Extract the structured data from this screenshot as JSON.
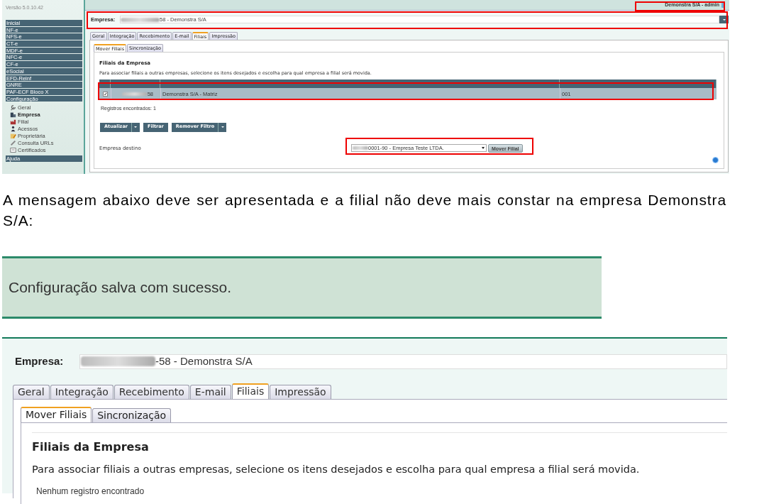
{
  "screenshot_1": {
    "version": "Versão 5.0.10.42",
    "user": "Demonstra S/A - admin",
    "sidebar": [
      {
        "label": "Inicial"
      },
      {
        "label": "NF-e"
      },
      {
        "label": "NFS-e"
      },
      {
        "label": "CT-e"
      },
      {
        "label": "MDF-e"
      },
      {
        "label": "NFC-e"
      },
      {
        "label": "CF-e"
      },
      {
        "label": "eSocial"
      },
      {
        "label": "EFD-Reinf"
      },
      {
        "label": "GNRE"
      },
      {
        "label": "PAF-ECF Bloco X"
      },
      {
        "label": "Configuração",
        "children": [
          {
            "label": "Geral",
            "selected": false
          },
          {
            "label": "Empresa",
            "selected": true
          },
          {
            "label": "Filial",
            "selected": false
          },
          {
            "label": "Acessos",
            "selected": false
          },
          {
            "label": "Proprietária",
            "selected": false
          },
          {
            "label": "Consulta URLs",
            "selected": false
          },
          {
            "label": "Certificados",
            "selected": false
          }
        ]
      },
      {
        "label": "Ajuda"
      }
    ],
    "empresa": {
      "label": "Empresa:",
      "value": "58 - Demonstra S/A"
    },
    "tabs": [
      {
        "label": "Geral",
        "selected": false
      },
      {
        "label": "Integração",
        "selected": false
      },
      {
        "label": "Recebimento",
        "selected": false
      },
      {
        "label": "E-mail",
        "selected": false
      },
      {
        "label": "Filiais",
        "selected": true
      },
      {
        "label": "Impressão",
        "selected": false
      }
    ],
    "subtabs": [
      {
        "label": "Mover Filiais",
        "selected": true
      },
      {
        "label": "Sincronização",
        "selected": false
      }
    ],
    "section_title": "Filiais da Empresa",
    "description": "Para associar filiais a outras empresas, selecione os itens desejados e escolha para qual empresa a filial será movida.",
    "table": {
      "rows": [
        {
          "checked": true,
          "cells": [
            "58",
            "Demonstra S/A - Matriz",
            "001"
          ]
        }
      ]
    },
    "record_count": "Registros encontrados: 1",
    "buttons": [
      {
        "label": "Atualizar",
        "dropdown": true
      },
      {
        "label": "Filtrar",
        "dropdown": false
      },
      {
        "label": "Remover Filtro",
        "dropdown": true
      }
    ],
    "destino": {
      "label": "Empresa destino",
      "value": "0001-90 - Empresa Teste LTDA.",
      "button": "Mover Filial"
    }
  },
  "paragraph": "A mensagem abaixo deve ser apresentada e a filial não deve mais constar na empresa Demonstra S/A:",
  "message": "Configuração salva com sucesso.",
  "screenshot_3": {
    "empresa": {
      "label": "Empresa:",
      "value": "-58 - Demonstra S/A"
    },
    "tabs": [
      {
        "label": "Geral",
        "selected": false
      },
      {
        "label": "Integração",
        "selected": false
      },
      {
        "label": "Recebimento",
        "selected": false
      },
      {
        "label": "E-mail",
        "selected": false
      },
      {
        "label": "Filiais",
        "selected": true
      },
      {
        "label": "Impressão",
        "selected": false
      }
    ],
    "subtabs": [
      {
        "label": "Mover Filiais",
        "selected": true
      },
      {
        "label": "Sincronização",
        "selected": false
      }
    ],
    "section_title": "Filiais da Empresa",
    "description": "Para associar filiais a outras empresas, selecione os itens desejados e escolha para qual empresa a filial será movida.",
    "empty_text": "Nenhum registro encontrado"
  }
}
